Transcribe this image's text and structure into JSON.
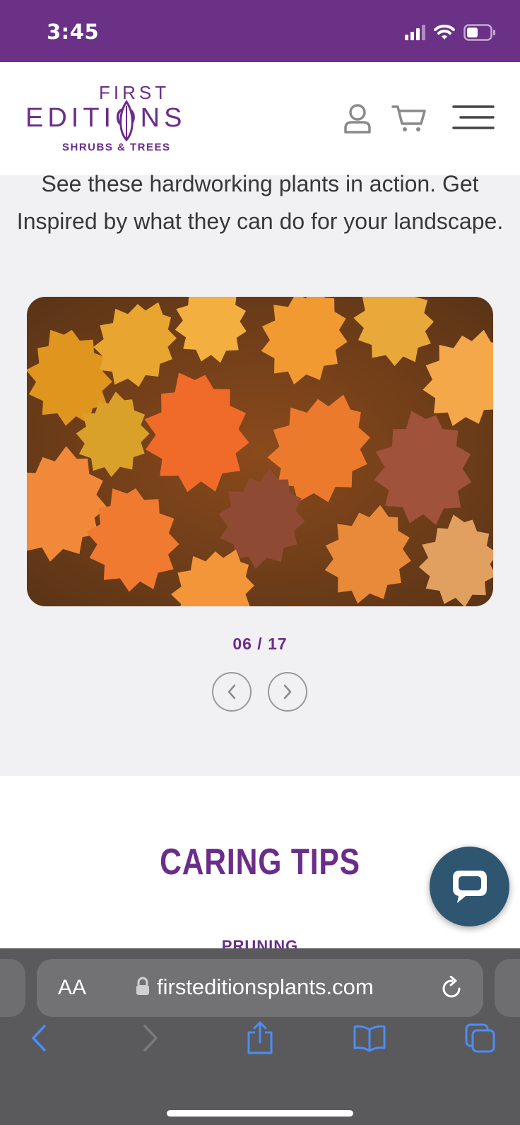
{
  "status_bar": {
    "time": "3:45"
  },
  "header": {
    "logo": {
      "line1": "FIRST",
      "line2": "EDITIONS",
      "tagline": "SHRUBS & TREES"
    },
    "icons": [
      "account-icon",
      "cart-icon",
      "menu-icon"
    ]
  },
  "intro": {
    "text": "See these hardworking plants in action. Get Inspired by what they can do for your landscape."
  },
  "gallery": {
    "image_subject": "orange and yellow ninebark foliage",
    "counter": "06 / 17",
    "prev_icon": "chevron-left-icon",
    "next_icon": "chevron-right-icon"
  },
  "caring_tips": {
    "title": "CARING TIPS",
    "first_item": "PRUNING"
  },
  "chat": {
    "icon": "chat-bubble-icon"
  },
  "browser": {
    "text_size_label": "AA",
    "url": "firsteditionsplants.com",
    "toolbar": [
      "back-icon",
      "forward-icon",
      "share-icon",
      "bookmarks-icon",
      "tabs-icon"
    ]
  },
  "colors": {
    "brand_purple": "#6b2d8a",
    "status_bar": "#6a3186",
    "chat_button": "#2e5670",
    "browser_accent": "#4c8cf5"
  }
}
